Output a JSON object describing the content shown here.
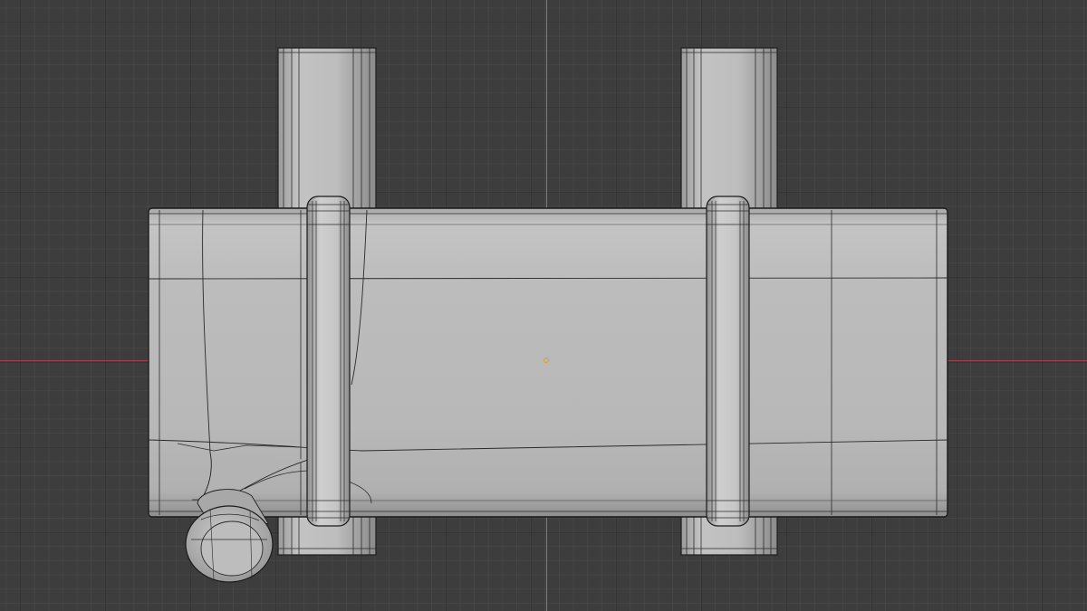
{
  "viewport": {
    "mode": "top-orthographic",
    "object": "muffler-model",
    "colors": {
      "background": "#3d3d3d",
      "x_axis": "#a4424c",
      "y_axis": "#7b8b2c",
      "mesh_fill": "#b7b7b7",
      "wire": "#1f1f1f",
      "origin": "#e0a020"
    }
  }
}
